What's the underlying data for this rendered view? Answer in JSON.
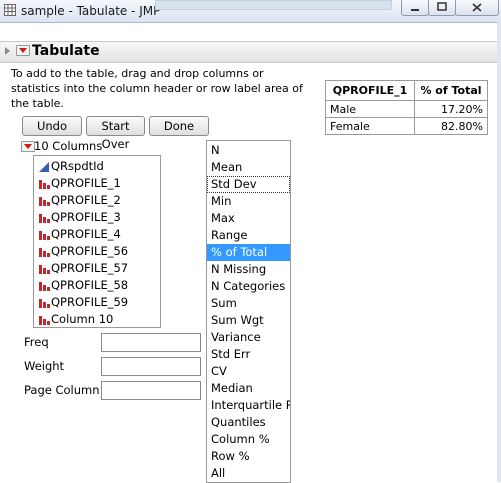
{
  "window": {
    "title": "sample - Tabulate - JMP"
  },
  "section": {
    "title": "Tabulate"
  },
  "instructions": "To add to the table, drag and drop columns or statistics into the column header or row label area of the table.",
  "result_table": {
    "headers": [
      "QPROFILE_1",
      "% of Total"
    ],
    "rows": [
      {
        "label": "Male",
        "value": "17.20%"
      },
      {
        "label": "Female",
        "value": "82.80%"
      }
    ]
  },
  "buttons": {
    "undo": "Undo",
    "start_over": "Start Over",
    "done": "Done"
  },
  "columns": {
    "header": "10 Columns",
    "items": [
      {
        "label": "QRspdtId",
        "icon": "continuous-icon"
      },
      {
        "label": "QPROFILE_1",
        "icon": "nominal-bar-icon"
      },
      {
        "label": "QPROFILE_2",
        "icon": "nominal-bar-icon"
      },
      {
        "label": "QPROFILE_3",
        "icon": "nominal-bar-icon"
      },
      {
        "label": "QPROFILE_4",
        "icon": "nominal-bar-icon"
      },
      {
        "label": "QPROFILE_56",
        "icon": "nominal-bar-icon"
      },
      {
        "label": "QPROFILE_57",
        "icon": "nominal-bar-icon"
      },
      {
        "label": "QPROFILE_58",
        "icon": "nominal-bar-icon"
      },
      {
        "label": "QPROFILE_59",
        "icon": "nominal-bar-icon"
      },
      {
        "label": "Column 10",
        "icon": "nominal-bar-icon"
      }
    ]
  },
  "roles": {
    "freq": "Freq",
    "weight": "Weight",
    "page_column": "Page Column"
  },
  "statistics": {
    "selected": "% of Total",
    "focused": "Std Dev",
    "items": [
      "N",
      "Mean",
      "Std Dev",
      "Min",
      "Max",
      "Range",
      "% of Total",
      "N Missing",
      "N Categories",
      "Sum",
      "Sum Wgt",
      "Variance",
      "Std Err",
      "CV",
      "Median",
      "Interquartile Ra",
      "Quantiles",
      "Column %",
      "Row %",
      "All"
    ]
  },
  "colors": {
    "selection": "#3399ff",
    "red_triangle": "#d01818",
    "nominal_icon": "#c0282d",
    "continuous_icon": "#3a5fae"
  }
}
